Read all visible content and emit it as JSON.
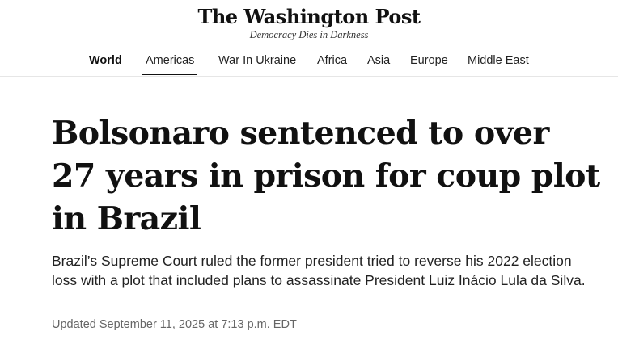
{
  "masthead": {
    "logo_text": "The Washington Post",
    "tagline": "Democracy Dies in Darkness"
  },
  "nav": {
    "items": [
      {
        "label": "World"
      },
      {
        "label": "Americas"
      },
      {
        "label": "War In Ukraine"
      },
      {
        "label": "Africa"
      },
      {
        "label": "Asia"
      },
      {
        "label": "Europe"
      },
      {
        "label": "Middle East"
      }
    ],
    "active": "Americas"
  },
  "article": {
    "headline": "Bolsonaro sentenced to over 27 years in prison for coup plot in Brazil",
    "dek": "Brazil’s Supreme Court ruled the former president tried to reverse his 2022 election loss with a plot that included plans to assassinate President Luiz Inácio Lula da Silva.",
    "timestamp": "Updated September 11, 2025 at 7:13 p.m. EDT"
  }
}
